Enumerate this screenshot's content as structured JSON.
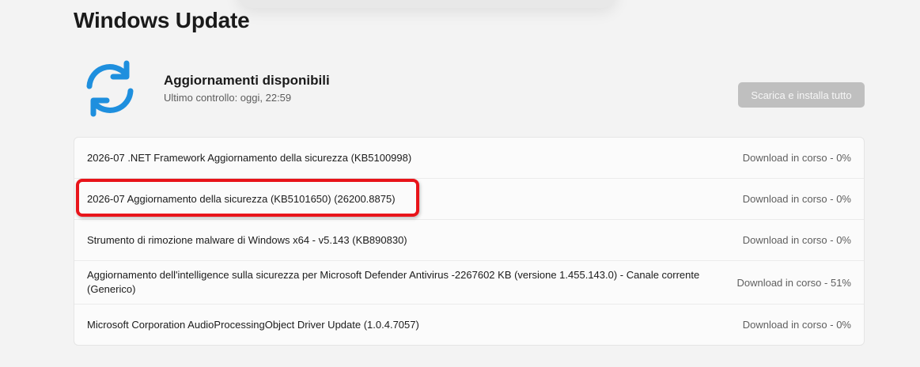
{
  "page": {
    "title": "Windows Update"
  },
  "status": {
    "icon": "sync-icon",
    "title": "Aggiornamenti disponibili",
    "subtitle": "Ultimo controllo: oggi, 22:59",
    "install_all_label": "Scarica e installa tutto"
  },
  "colors": {
    "accent": "#1e8fde",
    "highlight": "#e8141a",
    "button_disabled": "#bfbfbf"
  },
  "updates": [
    {
      "name": "2026-07 .NET Framework Aggiornamento della sicurezza (KB5100998)",
      "status": "Download in corso - 0%"
    },
    {
      "name": "2026-07 Aggiornamento della sicurezza (KB5101650) (26200.8875)",
      "status": "Download in corso - 0%"
    },
    {
      "name": "Strumento di rimozione malware di Windows x64 - v5.143 (KB890830)",
      "status": "Download in corso - 0%"
    },
    {
      "name": "Aggiornamento dell'intelligence sulla sicurezza per Microsoft Defender Antivirus -2267602 KB (versione 1.455.143.0) - Canale corrente (Generico)",
      "status": "Download in corso - 51%"
    },
    {
      "name": "Microsoft Corporation AudioProcessingObject Driver Update (1.0.4.7057)",
      "status": "Download in corso - 0%"
    }
  ]
}
